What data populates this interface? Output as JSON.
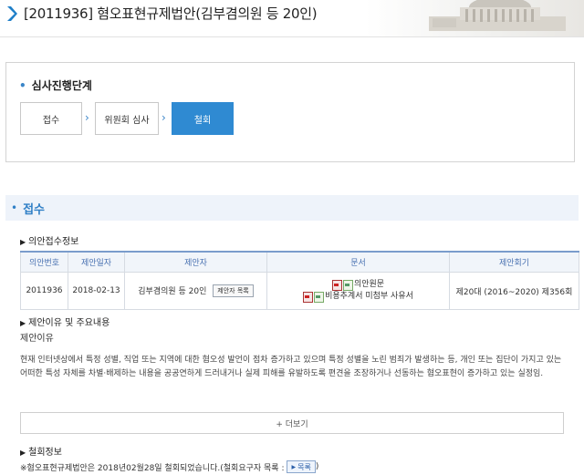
{
  "header": {
    "title": "[2011936] 혐오표현규제법안(김부겸의원 등 20인)"
  },
  "stage": {
    "title": "심사진행단계",
    "steps": [
      {
        "label": "접수",
        "active": false
      },
      {
        "label": "위원회 심사",
        "active": false
      },
      {
        "label": "철회",
        "active": true
      }
    ]
  },
  "section": {
    "title": "접수"
  },
  "receipt": {
    "heading": "의안접수정보",
    "columns": [
      "의안번호",
      "제안일자",
      "제안자",
      "문서",
      "제안회기"
    ],
    "row": {
      "bill_no": "2011936",
      "date": "2018-02-13",
      "proposer": "김부겸의원 등 20인",
      "proposer_button": "제안자 목록",
      "doc1": "의안원문",
      "doc2": "비용추계서 미첨부 사유서",
      "session": "제20대 (2016~2020) 제356회"
    }
  },
  "reason": {
    "heading": "제안이유 및 주요내용",
    "label": "제안이유",
    "text": "현재 인터넷상에서 특정 성별, 직업 또는 지역에 대한 혐오성 발언이 점차 증가하고 있으며 특정 성별을 노린 범죄가 발생하는 등, 개인 또는 집단이 가지고 있는 어떠한 특성 자체를 차별·배제하는 내용을 공공연하게 드러내거나 실제 피해를 유발하도록 편견을 조장하거나 선동하는 혐오표현이 증가하고 있는 실정임.",
    "more": "+ 더보기"
  },
  "withdraw": {
    "heading": "철회정보",
    "note": "※혐오표현규제법안은 2018년02월28일 철회되었습니다.(철회요구자 목록 :",
    "button": "목록",
    "close": ")"
  },
  "colors": {
    "accent": "#2f8ad2",
    "section_text": "#2f7fc6",
    "section_bg": "#eef3fa"
  }
}
